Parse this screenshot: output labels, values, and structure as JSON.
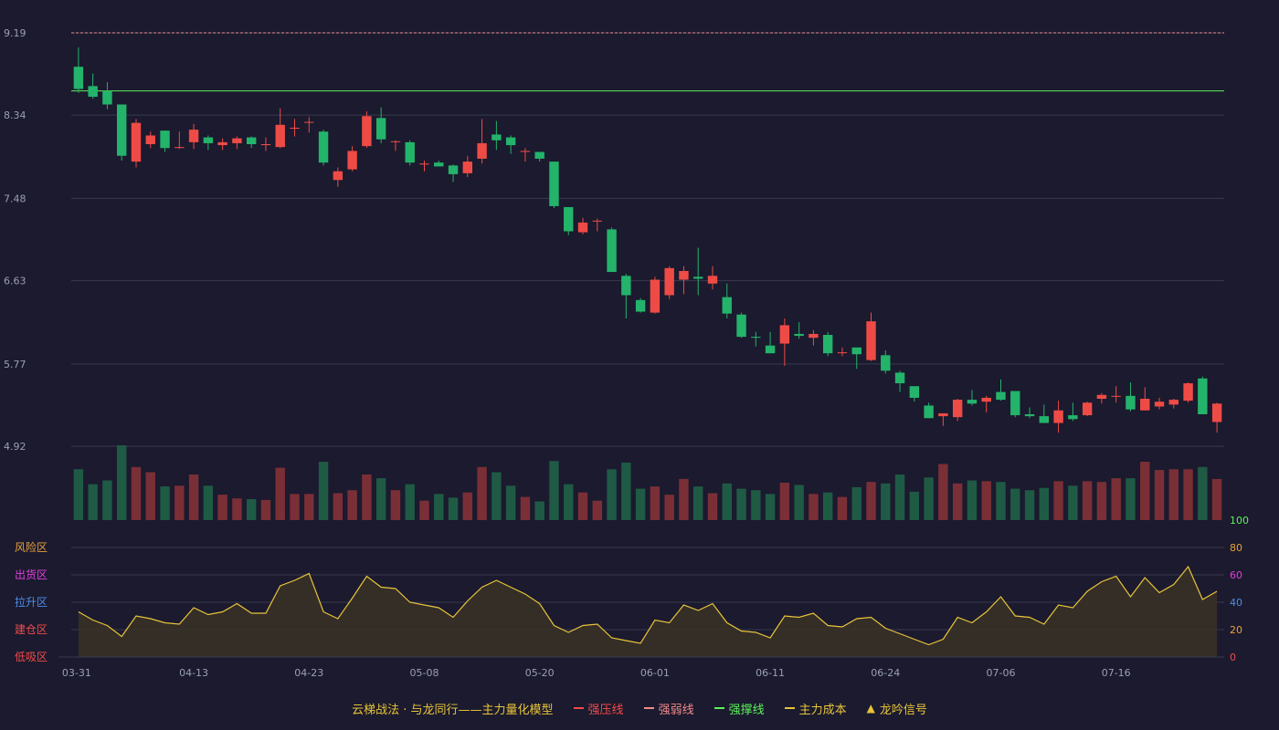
{
  "chart_data": {
    "type": "candlestick",
    "price_axis": {
      "ylim": [
        4.92,
        9.19
      ],
      "ticks": [
        "9.19",
        "8.34",
        "7.48",
        "6.63",
        "5.77",
        "4.92"
      ]
    },
    "indicator_axis": {
      "ylim": [
        0,
        100
      ],
      "ticks": [
        "100",
        "80",
        "60",
        "40",
        "20",
        "0"
      ]
    },
    "zones": [
      {
        "label": "风险区",
        "value": 80,
        "color": "#e8a13a"
      },
      {
        "label": "出货区",
        "value": 60,
        "color": "#e040e0"
      },
      {
        "label": "拉升区",
        "value": 40,
        "color": "#4d8fe8"
      },
      {
        "label": "建仓区",
        "value": 20,
        "color": "#f24a4a"
      },
      {
        "label": "低吸区",
        "value": 0,
        "color": "#f24a4a"
      }
    ],
    "x_ticks": [
      {
        "index": 0,
        "label": "03-31"
      },
      {
        "index": 8,
        "label": "04-13"
      },
      {
        "index": 16,
        "label": "04-23"
      },
      {
        "index": 24,
        "label": "05-08"
      },
      {
        "index": 32,
        "label": "05-20"
      },
      {
        "index": 40,
        "label": "06-01"
      },
      {
        "index": 48,
        "label": "06-11"
      },
      {
        "index": 56,
        "label": "06-24"
      },
      {
        "index": 64,
        "label": "07-06"
      },
      {
        "index": 72,
        "label": "07-16"
      }
    ],
    "reference_lines": [
      {
        "name": "强弱线",
        "value": 9.19,
        "style": "dashed",
        "color": "#f28b8b"
      },
      {
        "name": "强撑线",
        "value": 8.59,
        "style": "solid",
        "color": "#5cf25c"
      }
    ],
    "candles": [
      [
        8.84,
        8.61,
        9.04,
        8.57
      ],
      [
        8.64,
        8.53,
        8.77,
        8.51
      ],
      [
        8.59,
        8.45,
        8.68,
        8.4
      ],
      [
        8.45,
        7.92,
        8.45,
        7.87
      ],
      [
        7.86,
        8.26,
        8.3,
        7.8
      ],
      [
        8.04,
        8.13,
        8.17,
        8.0
      ],
      [
        8.18,
        8.0,
        8.18,
        7.96
      ],
      [
        8.0,
        8.01,
        8.17,
        7.99
      ],
      [
        8.06,
        8.19,
        8.25,
        7.99
      ],
      [
        8.11,
        8.05,
        8.13,
        7.98
      ],
      [
        8.03,
        8.06,
        8.1,
        7.98
      ],
      [
        8.05,
        8.1,
        8.12,
        7.99
      ],
      [
        8.11,
        8.04,
        8.12,
        8.0
      ],
      [
        8.03,
        8.04,
        8.11,
        7.97
      ],
      [
        8.01,
        8.24,
        8.41,
        8.0
      ],
      [
        8.2,
        8.21,
        8.3,
        8.12
      ],
      [
        8.27,
        8.27,
        8.32,
        8.16
      ],
      [
        8.17,
        7.85,
        8.19,
        7.82
      ],
      [
        7.67,
        7.76,
        7.8,
        7.6
      ],
      [
        7.78,
        7.97,
        8.02,
        7.76
      ],
      [
        8.02,
        8.33,
        8.38,
        8.0
      ],
      [
        8.31,
        8.09,
        8.42,
        8.05
      ],
      [
        8.07,
        8.07,
        8.08,
        7.97
      ],
      [
        8.06,
        7.85,
        8.08,
        7.82
      ],
      [
        7.83,
        7.84,
        7.87,
        7.76
      ],
      [
        7.85,
        7.81,
        7.87,
        7.81
      ],
      [
        7.82,
        7.73,
        7.83,
        7.65
      ],
      [
        7.74,
        7.86,
        7.92,
        7.7
      ],
      [
        7.89,
        8.05,
        8.3,
        7.84
      ],
      [
        8.14,
        8.08,
        8.28,
        7.98
      ],
      [
        8.11,
        8.03,
        8.13,
        7.94
      ],
      [
        7.96,
        7.97,
        8.0,
        7.86
      ],
      [
        7.96,
        7.89,
        7.96,
        7.86
      ],
      [
        7.86,
        7.4,
        7.86,
        7.38
      ],
      [
        7.39,
        7.14,
        7.39,
        7.1
      ],
      [
        7.13,
        7.23,
        7.28,
        7.11
      ],
      [
        7.25,
        7.25,
        7.27,
        7.14
      ],
      [
        7.16,
        6.72,
        7.18,
        6.72
      ],
      [
        6.68,
        6.48,
        6.7,
        6.24
      ],
      [
        6.43,
        6.31,
        6.45,
        6.3
      ],
      [
        6.3,
        6.64,
        6.67,
        6.29
      ],
      [
        6.48,
        6.76,
        6.78,
        6.44
      ],
      [
        6.64,
        6.73,
        6.78,
        6.49
      ],
      [
        6.67,
        6.65,
        6.97,
        6.48
      ],
      [
        6.6,
        6.68,
        6.78,
        6.54
      ],
      [
        6.46,
        6.29,
        6.6,
        6.24
      ],
      [
        6.28,
        6.05,
        6.3,
        6.04
      ],
      [
        6.05,
        6.04,
        6.1,
        5.95
      ],
      [
        5.96,
        5.88,
        6.1,
        5.88
      ],
      [
        5.98,
        6.17,
        6.24,
        5.75
      ],
      [
        6.08,
        6.06,
        6.2,
        6.03
      ],
      [
        6.04,
        6.08,
        6.12,
        5.96
      ],
      [
        6.07,
        5.88,
        6.1,
        5.85
      ],
      [
        5.89,
        5.89,
        5.94,
        5.85
      ],
      [
        5.94,
        5.87,
        5.93,
        5.72
      ],
      [
        5.81,
        6.21,
        6.3,
        5.8
      ],
      [
        5.86,
        5.7,
        5.91,
        5.67
      ],
      [
        5.68,
        5.57,
        5.7,
        5.48
      ],
      [
        5.54,
        5.42,
        5.53,
        5.38
      ],
      [
        5.34,
        5.21,
        5.37,
        5.21
      ],
      [
        5.23,
        5.26,
        5.26,
        5.13
      ],
      [
        5.22,
        5.4,
        5.41,
        5.18
      ],
      [
        5.4,
        5.36,
        5.5,
        5.34
      ],
      [
        5.38,
        5.42,
        5.44,
        5.27
      ],
      [
        5.48,
        5.4,
        5.61,
        5.39
      ],
      [
        5.49,
        5.24,
        5.49,
        5.22
      ],
      [
        5.25,
        5.23,
        5.32,
        5.21
      ],
      [
        5.23,
        5.16,
        5.35,
        5.16
      ],
      [
        5.16,
        5.29,
        5.39,
        5.06
      ],
      [
        5.24,
        5.2,
        5.37,
        5.18
      ],
      [
        5.24,
        5.37,
        5.38,
        5.23
      ],
      [
        5.41,
        5.45,
        5.47,
        5.36
      ],
      [
        5.44,
        5.44,
        5.54,
        5.37
      ],
      [
        5.44,
        5.3,
        5.58,
        5.28
      ],
      [
        5.29,
        5.41,
        5.53,
        5.29
      ],
      [
        5.33,
        5.38,
        5.42,
        5.3
      ],
      [
        5.35,
        5.4,
        5.41,
        5.31
      ],
      [
        5.39,
        5.57,
        5.58,
        5.37
      ],
      [
        5.62,
        5.25,
        5.64,
        5.25
      ],
      [
        5.17,
        5.36,
        5.37,
        5.06
      ]
    ],
    "volume_relative": [
      0.68,
      0.48,
      0.53,
      1.0,
      0.71,
      0.64,
      0.45,
      0.46,
      0.61,
      0.46,
      0.34,
      0.29,
      0.28,
      0.27,
      0.7,
      0.35,
      0.35,
      0.78,
      0.36,
      0.4,
      0.61,
      0.56,
      0.4,
      0.48,
      0.26,
      0.35,
      0.3,
      0.37,
      0.71,
      0.64,
      0.46,
      0.31,
      0.25,
      0.79,
      0.48,
      0.37,
      0.26,
      0.68,
      0.77,
      0.42,
      0.45,
      0.34,
      0.55,
      0.45,
      0.36,
      0.49,
      0.42,
      0.4,
      0.35,
      0.5,
      0.47,
      0.35,
      0.37,
      0.31,
      0.44,
      0.51,
      0.49,
      0.61,
      0.38,
      0.57,
      0.75,
      0.49,
      0.53,
      0.52,
      0.51,
      0.42,
      0.4,
      0.43,
      0.52,
      0.46,
      0.52,
      0.51,
      0.56,
      0.56,
      0.78,
      0.67,
      0.68,
      0.68,
      0.71,
      0.55
    ],
    "indicator_line": [
      33,
      27,
      23,
      15,
      30,
      28,
      25,
      24,
      36,
      31,
      33,
      39,
      32,
      32,
      52,
      56,
      61,
      33,
      28,
      43,
      59,
      51,
      50,
      40,
      38,
      36,
      29,
      41,
      51,
      56,
      51,
      46,
      39,
      23,
      18,
      23,
      24,
      14,
      12,
      10,
      27,
      25,
      38,
      34,
      39,
      25,
      19,
      18,
      14,
      30,
      29,
      32,
      23,
      22,
      28,
      29,
      21,
      17,
      13,
      9,
      13,
      29,
      25,
      33,
      44,
      30,
      29,
      24,
      38,
      36,
      48,
      55,
      59,
      44,
      58,
      47,
      53,
      66,
      42,
      48
    ],
    "legend": {
      "title": "云梯战法 · 与龙同行——主力量化模型",
      "items": [
        {
          "label": "强压线",
          "color": "#f24a4a",
          "style": "solid"
        },
        {
          "label": "强弱线",
          "color": "#f28b8b",
          "style": "dashed"
        },
        {
          "label": "强撑线",
          "color": "#5cf25c",
          "style": "solid"
        },
        {
          "label": "主力成本",
          "color": "#e8c43a",
          "style": "dashed"
        },
        {
          "label": "龙吟信号",
          "color": "#e8c43a",
          "style": "triangle",
          "glyph": "▲"
        }
      ]
    },
    "colors": {
      "background": "#1b1a2e",
      "up": "#ef4b46",
      "down": "#24b36b",
      "volume_up": "#7a2f36",
      "volume_down": "#1f5a45",
      "grid": "#3a3a4e",
      "axis_text": "#9aa0b3",
      "indicator_line": "#e8c43a",
      "indicator_fill": "#3a3326",
      "indicator_axis_top": "#5cf25c",
      "indicator_axis_text": "#e8a13a",
      "indicator_axis_low": "#f24a4a"
    }
  }
}
